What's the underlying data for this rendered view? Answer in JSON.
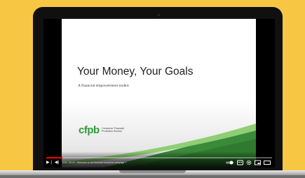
{
  "slide": {
    "title": "Your Money, Your Goals",
    "subtitle": "A financial empowerment toolkit",
    "logo": {
      "mark": "cfpb",
      "name_line1": "Consumer Financial",
      "name_line2": "Protection Bureau"
    }
  },
  "player": {
    "progress_fraction": 0.07,
    "time_chapter": "0:01 / 30:31 • Welcome to the financial educators webpage >",
    "icons": {
      "next": "next-icon",
      "volume": "volume-icon",
      "autoplay": "autoplay-toggle-icon",
      "captions": "captions-icon",
      "settings": "gear-icon",
      "miniplayer": "miniplayer-icon",
      "theater": "theater-icon"
    }
  },
  "colors": {
    "background": "#f7c744",
    "brand_green": "#2f9b3a",
    "progress_red": "#ff0000"
  }
}
